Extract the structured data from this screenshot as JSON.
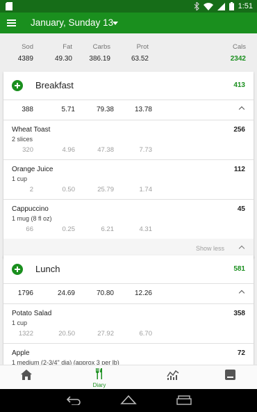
{
  "status_bar": {
    "time": "1:51"
  },
  "header": {
    "title": "January, Sunday 13"
  },
  "totals": {
    "labels": {
      "sod": "Sod",
      "fat": "Fat",
      "carbs": "Carbs",
      "prot": "Prot",
      "cals": "Cals"
    },
    "values": {
      "sod": "4389",
      "fat": "49.30",
      "carbs": "386.19",
      "prot": "63.52",
      "cals": "2342"
    }
  },
  "meals": [
    {
      "title": "Breakfast",
      "cals": "413",
      "summary": {
        "sod": "388",
        "fat": "5.71",
        "carbs": "79.38",
        "prot": "13.78"
      },
      "items": [
        {
          "name": "Wheat Toast",
          "serving": "2 slices",
          "cals": "256",
          "sod": "320",
          "fat": "4.96",
          "carbs": "47.38",
          "prot": "7.73"
        },
        {
          "name": "Orange Juice",
          "serving": "1 cup",
          "cals": "112",
          "sod": "2",
          "fat": "0.50",
          "carbs": "25.79",
          "prot": "1.74"
        },
        {
          "name": "Cappuccino",
          "serving": "1 mug (8 fl oz)",
          "cals": "45",
          "sod": "66",
          "fat": "0.25",
          "carbs": "6.21",
          "prot": "4.31"
        }
      ],
      "show_less": "Show less"
    },
    {
      "title": "Lunch",
      "cals": "581",
      "summary": {
        "sod": "1796",
        "fat": "24.69",
        "carbs": "70.80",
        "prot": "12.26"
      },
      "items": [
        {
          "name": "Potato Salad",
          "serving": "1 cup",
          "cals": "358",
          "sod": "1322",
          "fat": "20.50",
          "carbs": "27.92",
          "prot": "6.70"
        },
        {
          "name": "Apple",
          "serving": "1 medium (2-3/4\" dia) (approx 3 per lb)",
          "cals": "72"
        }
      ]
    }
  ],
  "bottom_nav": {
    "diary_label": "Diary"
  },
  "colors": {
    "primary": "#1a8f1e",
    "status_bar": "#166d18"
  }
}
